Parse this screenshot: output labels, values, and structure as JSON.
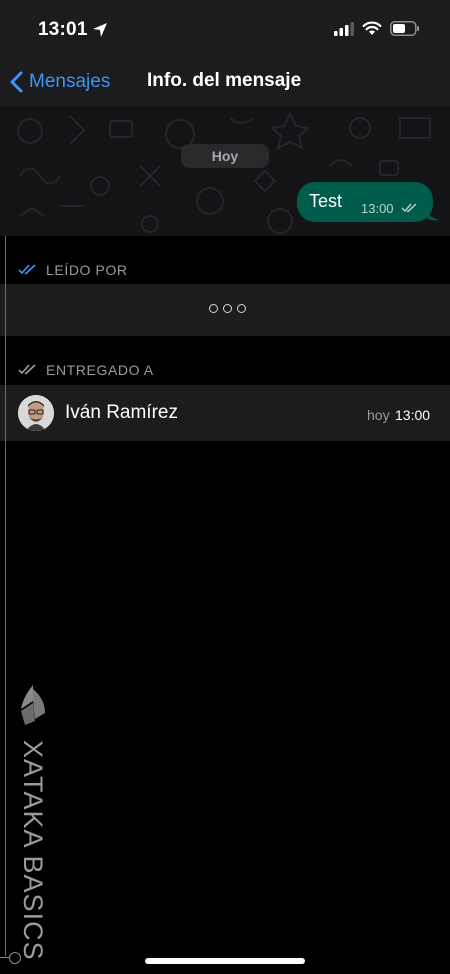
{
  "status_bar": {
    "time": "13:01"
  },
  "nav": {
    "back_label": "Mensajes",
    "title": "Info. del mensaje"
  },
  "chat": {
    "date_label": "Hoy",
    "message": {
      "text": "Test",
      "time": "13:00"
    }
  },
  "read_section": {
    "title": "LEÍDO POR"
  },
  "delivered_section": {
    "title": "ENTREGADO A"
  },
  "contact": {
    "name": "Iván Ramírez",
    "day": "hoy",
    "time": "13:00"
  },
  "watermark": {
    "brand": "XATAKA BASICS"
  },
  "colors": {
    "accent": "#3d95f5",
    "bubble": "#005c4b",
    "background": "#000000",
    "row": "#1c1c1e"
  }
}
